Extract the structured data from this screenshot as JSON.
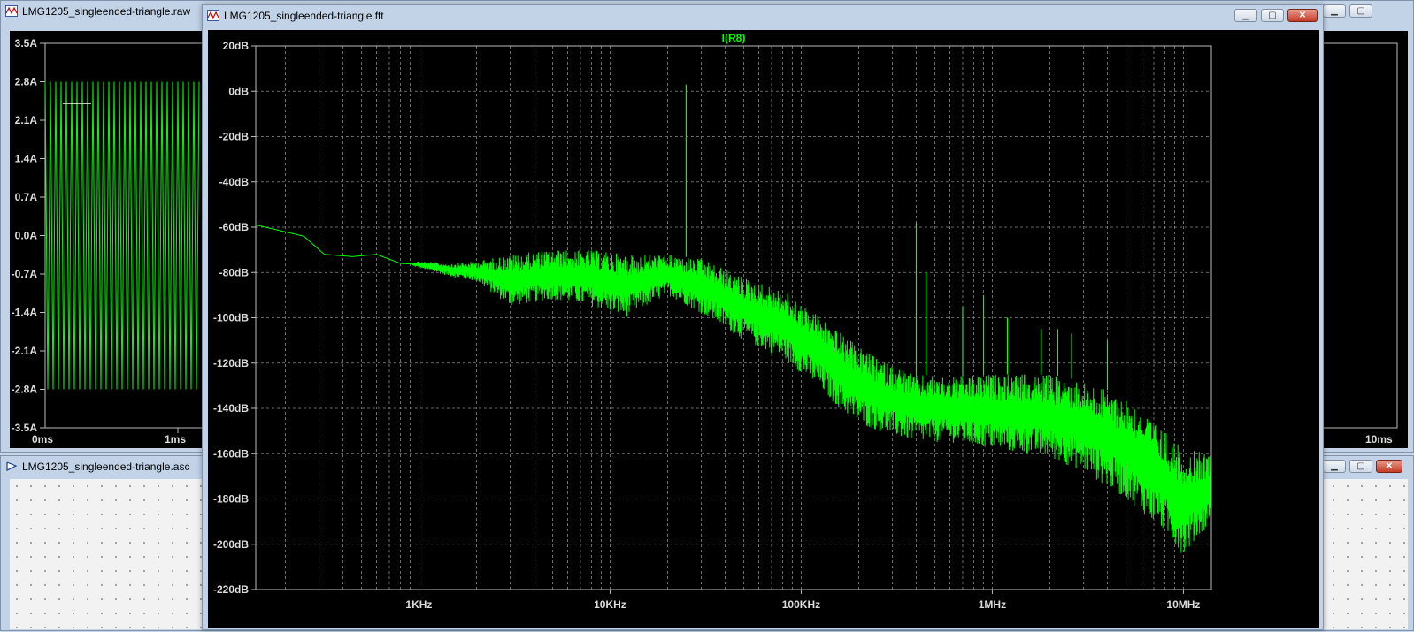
{
  "windows": {
    "raw": {
      "title": "LMG1205_singleended-triangle.raw",
      "y_ticks": [
        "3.5A",
        "2.8A",
        "2.1A",
        "1.4A",
        "0.7A",
        "0.0A",
        "-0.7A",
        "-1.4A",
        "-2.1A",
        "-2.8A",
        "-3.5A"
      ],
      "x_ticks": [
        "0ms",
        "1ms",
        "10ms"
      ],
      "buttons": {
        "minimize": "▁",
        "maximize": "▢"
      }
    },
    "asc": {
      "title": "LMG1205_singleended-triangle.asc",
      "buttons": {
        "minimize": "▁",
        "maximize": "▢",
        "close": "✕"
      }
    },
    "fft": {
      "title": "LMG1205_singleended-triangle.fft",
      "buttons": {
        "minimize": "▁",
        "maximize": "▢",
        "close": "✕"
      }
    }
  },
  "colors": {
    "trace": "#00ff00",
    "grid": "#888888",
    "axis_text": "#dddddd",
    "plot_bg": "#000000"
  },
  "chart_data": {
    "type": "line",
    "title": "I(R8)",
    "x_scale": "log",
    "x_unit": "Hz",
    "xlim": [
      140,
      14000000
    ],
    "ylim": [
      -220,
      20
    ],
    "x_tick_labels": [
      "1KHz",
      "10KHz",
      "100KHz",
      "1MHz",
      "10MHz"
    ],
    "x_tick_values": [
      1000,
      10000,
      100000,
      1000000,
      10000000
    ],
    "y_tick_labels": [
      "20dB",
      "0dB",
      "-20dB",
      "-40dB",
      "-60dB",
      "-80dB",
      "-100dB",
      "-120dB",
      "-140dB",
      "-160dB",
      "-180dB",
      "-200dB",
      "-220dB"
    ],
    "y_tick_values": [
      20,
      0,
      -20,
      -40,
      -60,
      -80,
      -100,
      -120,
      -140,
      -160,
      -180,
      -200,
      -220
    ],
    "grid": true,
    "series": [
      {
        "name": "I(R8)",
        "envelope": [
          [
            140,
            -59,
            -59
          ],
          [
            250,
            -64,
            -64
          ],
          [
            320,
            -72,
            -72
          ],
          [
            450,
            -73,
            -73
          ],
          [
            600,
            -72,
            -72
          ],
          [
            800,
            -76,
            -76
          ],
          [
            1000,
            -78,
            -75
          ],
          [
            1500,
            -82,
            -76
          ],
          [
            2000,
            -84,
            -75
          ],
          [
            3000,
            -95,
            -72
          ],
          [
            5000,
            -92,
            -70
          ],
          [
            8000,
            -95,
            -70
          ],
          [
            12000,
            -100,
            -72
          ],
          [
            20000,
            -90,
            -72
          ],
          [
            30000,
            -98,
            -74
          ],
          [
            50000,
            -110,
            -82
          ],
          [
            80000,
            -118,
            -88
          ],
          [
            120000,
            -130,
            -98
          ],
          [
            180000,
            -145,
            -110
          ],
          [
            250000,
            -150,
            -118
          ],
          [
            400000,
            -155,
            -125
          ],
          [
            600000,
            -155,
            -126
          ],
          [
            1000000,
            -158,
            -125
          ],
          [
            2000000,
            -162,
            -125
          ],
          [
            3000000,
            -168,
            -128
          ],
          [
            5000000,
            -180,
            -135
          ],
          [
            8000000,
            -195,
            -150
          ],
          [
            10000000,
            -205,
            -158
          ],
          [
            14000000,
            -190,
            -160
          ]
        ],
        "spikes": [
          [
            25000,
            3
          ],
          [
            400000,
            -58
          ],
          [
            450000,
            -80
          ],
          [
            700000,
            -95
          ],
          [
            900000,
            -90
          ],
          [
            1200000,
            -100
          ],
          [
            1800000,
            -105
          ],
          [
            2200000,
            -105
          ],
          [
            2600000,
            -107
          ],
          [
            4000000,
            -110
          ]
        ]
      }
    ]
  }
}
